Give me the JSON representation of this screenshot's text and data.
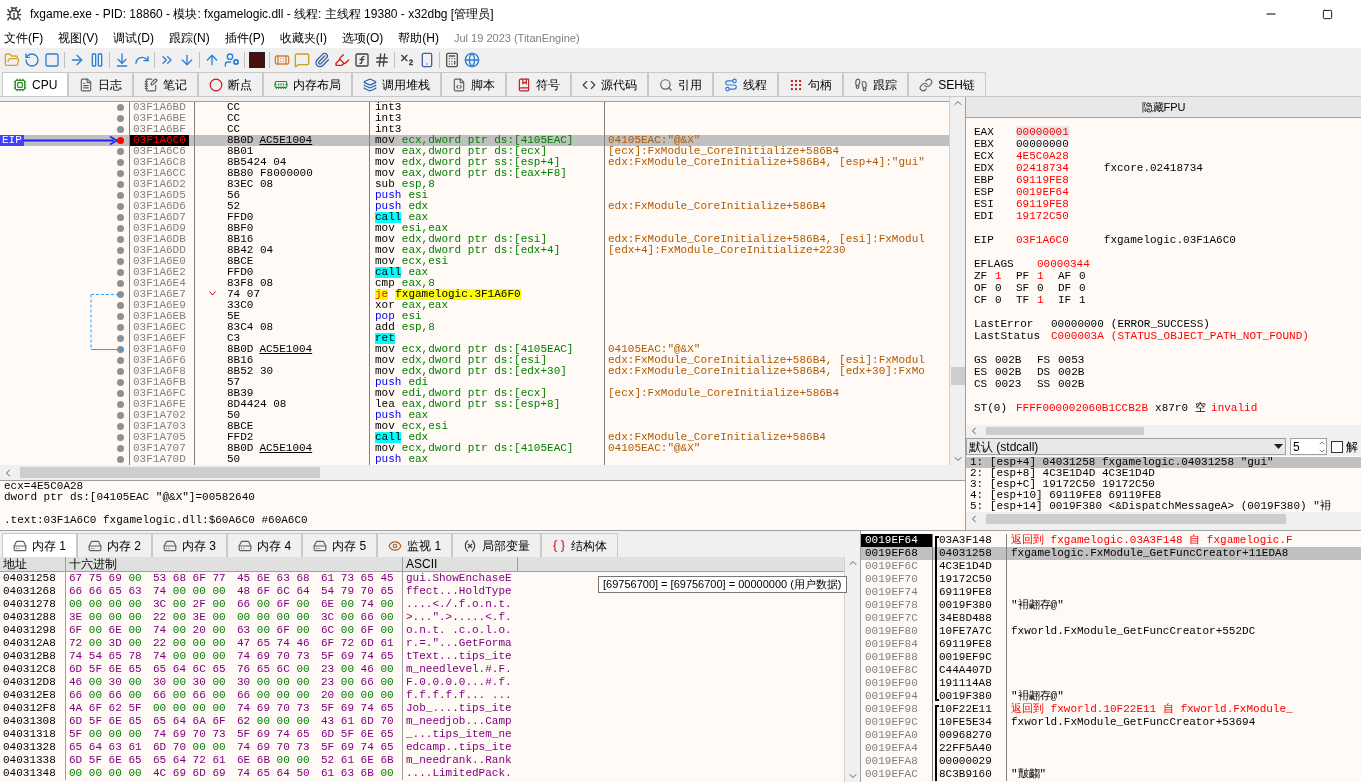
{
  "window": {
    "title": "fxgame.exe - PID: 18860 - 模块: fxgamelogic.dll - 线程: 主线程 19380 - x32dbg [管理员]"
  },
  "menu": [
    "文件(F)",
    "视图(V)",
    "调试(D)",
    "跟踪(N)",
    "插件(P)",
    "收藏夹(I)",
    "选项(O)",
    "帮助(H)"
  ],
  "build_info": "Jul 19 2023 (TitanEngine)",
  "tabs": [
    {
      "label": "CPU",
      "selected": true
    },
    {
      "label": "日志",
      "selected": false
    },
    {
      "label": "笔记",
      "selected": false
    },
    {
      "label": "断点",
      "selected": false
    },
    {
      "label": "内存布局",
      "selected": false
    },
    {
      "label": "调用堆栈",
      "selected": false
    },
    {
      "label": "脚本",
      "selected": false
    },
    {
      "label": "符号",
      "selected": false
    },
    {
      "label": "源代码",
      "selected": false
    },
    {
      "label": "引用",
      "selected": false
    },
    {
      "label": "线程",
      "selected": false
    },
    {
      "label": "句柄",
      "selected": false
    },
    {
      "label": "跟踪",
      "selected": false
    },
    {
      "label": "SEH链",
      "selected": false
    }
  ],
  "eip_label": "EIP",
  "disassembly": [
    {
      "address": "03F1A6BD",
      "bytes": "CC",
      "mnemonic": "int3",
      "kind": "normal",
      "breakpoint": false,
      "selected": false,
      "eip": false,
      "jump_from": false,
      "jump_to": false
    },
    {
      "address": "03F1A6BE",
      "bytes": "CC",
      "mnemonic": "int3",
      "kind": "normal",
      "breakpoint": false,
      "selected": false,
      "eip": false,
      "jump_from": false,
      "jump_to": false
    },
    {
      "address": "03F1A6BF",
      "bytes": "CC",
      "mnemonic": "int3",
      "kind": "normal",
      "breakpoint": false,
      "selected": false,
      "eip": false,
      "jump_from": false,
      "jump_to": false
    },
    {
      "address": "03F1A6C0",
      "bytes": "8B0D",
      "reloc": "AC5E1004",
      "mnemonic": "mov",
      "operands": "ecx,dword ptr ds:[4105EAC]",
      "comment": "04105EAC:\"@&X\"",
      "kind": "normal",
      "breakpoint": true,
      "selected": true,
      "eip": true,
      "jump_from": false,
      "jump_to": false
    },
    {
      "address": "03F1A6C6",
      "bytes": "8B01",
      "mnemonic": "mov",
      "operands": "eax,dword ptr ds:[ecx]",
      "comment": "[ecx]:FxModule_CoreInitialize+586B4",
      "kind": "normal",
      "breakpoint": false,
      "selected": false,
      "eip": false,
      "jump_from": false,
      "jump_to": false
    },
    {
      "address": "03F1A6C8",
      "bytes": "8B5424 04",
      "mnemonic": "mov",
      "operands": "edx,dword ptr ss:[esp+4]",
      "comment": "edx:FxModule_CoreInitialize+586B4, [esp+4]:\"gui\"",
      "kind": "normal",
      "breakpoint": false,
      "selected": false,
      "eip": false,
      "jump_from": false,
      "jump_to": false
    },
    {
      "address": "03F1A6CC",
      "bytes": "8B80 F8000000",
      "mnemonic": "mov",
      "operands": "eax,dword ptr ds:[eax+F8]",
      "kind": "normal",
      "breakpoint": false,
      "selected": false,
      "eip": false,
      "jump_from": false,
      "jump_to": false
    },
    {
      "address": "03F1A6D2",
      "bytes": "83EC 08",
      "mnemonic": "sub",
      "operands": "esp,8",
      "kind": "normal",
      "breakpoint": false,
      "selected": false,
      "eip": false,
      "jump_from": false,
      "jump_to": false
    },
    {
      "address": "03F1A6D5",
      "bytes": "56",
      "mnemonic": "push",
      "operands": "esi",
      "kind": "stack",
      "breakpoint": false,
      "selected": false,
      "eip": false,
      "jump_from": false,
      "jump_to": false
    },
    {
      "address": "03F1A6D6",
      "bytes": "52",
      "mnemonic": "push",
      "operands": "edx",
      "comment": "edx:FxModule_CoreInitialize+586B4",
      "kind": "stack",
      "breakpoint": false,
      "selected": false,
      "eip": false,
      "jump_from": false,
      "jump_to": false
    },
    {
      "address": "03F1A6D7",
      "bytes": "FFD0",
      "mnemonic": "call",
      "operands": "eax",
      "kind": "call",
      "breakpoint": false,
      "selected": false,
      "eip": false,
      "jump_from": false,
      "jump_to": false
    },
    {
      "address": "03F1A6D9",
      "bytes": "8BF0",
      "mnemonic": "mov",
      "operands": "esi,eax",
      "kind": "normal",
      "breakpoint": false,
      "selected": false,
      "eip": false,
      "jump_from": false,
      "jump_to": false
    },
    {
      "address": "03F1A6DB",
      "bytes": "8B16",
      "mnemonic": "mov",
      "operands": "edx,dword ptr ds:[esi]",
      "comment": "edx:FxModule_CoreInitialize+586B4, [esi]:FxModul",
      "kind": "normal",
      "breakpoint": false,
      "selected": false,
      "eip": false,
      "jump_from": false,
      "jump_to": false
    },
    {
      "address": "03F1A6DD",
      "bytes": "8B42 04",
      "mnemonic": "mov",
      "operands": "eax,dword ptr ds:[edx+4]",
      "comment": "[edx+4]:FxModule_CoreInitialize+2230",
      "kind": "normal",
      "breakpoint": false,
      "selected": false,
      "eip": false,
      "jump_from": false,
      "jump_to": false
    },
    {
      "address": "03F1A6E0",
      "bytes": "8BCE",
      "mnemonic": "mov",
      "operands": "ecx,esi",
      "kind": "normal",
      "breakpoint": false,
      "selected": false,
      "eip": false,
      "jump_from": false,
      "jump_to": false
    },
    {
      "address": "03F1A6E2",
      "bytes": "FFD0",
      "mnemonic": "call",
      "operands": "eax",
      "kind": "call",
      "breakpoint": false,
      "selected": false,
      "eip": false,
      "jump_from": false,
      "jump_to": false
    },
    {
      "address": "03F1A6E4",
      "bytes": "83F8 08",
      "mnemonic": "cmp",
      "operands": "eax,8",
      "kind": "normal",
      "breakpoint": false,
      "selected": false,
      "eip": false,
      "jump_from": false,
      "jump_to": false
    },
    {
      "address": "03F1A6E7",
      "bytes": "74 07",
      "mnemonic": "je",
      "operands": "fxgamelogic.3F1A6F0",
      "kind": "jump",
      "breakpoint": false,
      "selected": false,
      "eip": false,
      "jump_from": true,
      "jump_to": false
    },
    {
      "address": "03F1A6E9",
      "bytes": "33C0",
      "mnemonic": "xor",
      "operands": "eax,eax",
      "kind": "normal",
      "breakpoint": false,
      "selected": false,
      "eip": false,
      "jump_from": false,
      "jump_to": false
    },
    {
      "address": "03F1A6EB",
      "bytes": "5E",
      "mnemonic": "pop",
      "operands": "esi",
      "kind": "stack",
      "breakpoint": false,
      "selected": false,
      "eip": false,
      "jump_from": false,
      "jump_to": false
    },
    {
      "address": "03F1A6EC",
      "bytes": "83C4 08",
      "mnemonic": "add",
      "operands": "esp,8",
      "kind": "normal",
      "breakpoint": false,
      "selected": false,
      "eip": false,
      "jump_from": false,
      "jump_to": false
    },
    {
      "address": "03F1A6EF",
      "bytes": "C3",
      "mnemonic": "ret",
      "kind": "call",
      "breakpoint": false,
      "selected": false,
      "eip": false,
      "jump_from": false,
      "jump_to": false
    },
    {
      "address": "03F1A6F0",
      "bytes": "8B0D",
      "reloc": "AC5E1004",
      "mnemonic": "mov",
      "operands": "ecx,dword ptr ds:[4105EAC]",
      "comment": "04105EAC:\"@&X\"",
      "kind": "normal",
      "breakpoint": false,
      "selected": false,
      "eip": false,
      "jump_from": false,
      "jump_to": true
    },
    {
      "address": "03F1A6F6",
      "bytes": "8B16",
      "mnemonic": "mov",
      "operands": "edx,dword ptr ds:[esi]",
      "comment": "edx:FxModule_CoreInitialize+586B4, [esi]:FxModul",
      "kind": "normal",
      "breakpoint": false,
      "selected": false,
      "eip": false,
      "jump_from": false,
      "jump_to": false
    },
    {
      "address": "03F1A6F8",
      "bytes": "8B52 30",
      "mnemonic": "mov",
      "operands": "edx,dword ptr ds:[edx+30]",
      "comment": "edx:FxModule_CoreInitialize+586B4, [edx+30]:FxMo",
      "kind": "normal",
      "breakpoint": false,
      "selected": false,
      "eip": false,
      "jump_from": false,
      "jump_to": false
    },
    {
      "address": "03F1A6FB",
      "bytes": "57",
      "mnemonic": "push",
      "operands": "edi",
      "kind": "stack",
      "breakpoint": false,
      "selected": false,
      "eip": false,
      "jump_from": false,
      "jump_to": false
    },
    {
      "address": "03F1A6FC",
      "bytes": "8B39",
      "mnemonic": "mov",
      "operands": "edi,dword ptr ds:[ecx]",
      "comment": "[ecx]:FxModule_CoreInitialize+586B4",
      "kind": "normal",
      "breakpoint": false,
      "selected": false,
      "eip": false,
      "jump_from": false,
      "jump_to": false
    },
    {
      "address": "03F1A6FE",
      "bytes": "8D4424 08",
      "mnemonic": "lea",
      "operands": "eax,dword ptr ss:[esp+8]",
      "kind": "normal",
      "breakpoint": false,
      "selected": false,
      "eip": false,
      "jump_from": false,
      "jump_to": false
    },
    {
      "address": "03F1A702",
      "bytes": "50",
      "mnemonic": "push",
      "operands": "eax",
      "kind": "stack",
      "breakpoint": false,
      "selected": false,
      "eip": false,
      "jump_from": false,
      "jump_to": false
    },
    {
      "address": "03F1A703",
      "bytes": "8BCE",
      "mnemonic": "mov",
      "operands": "ecx,esi",
      "kind": "normal",
      "breakpoint": false,
      "selected": false,
      "eip": false,
      "jump_from": false,
      "jump_to": false
    },
    {
      "address": "03F1A705",
      "bytes": "FFD2",
      "mnemonic": "call",
      "operands": "edx",
      "comment": "edx:FxModule_CoreInitialize+586B4",
      "kind": "call",
      "breakpoint": false,
      "selected": false,
      "eip": false,
      "jump_from": false,
      "jump_to": false
    },
    {
      "address": "03F1A707",
      "bytes": "8B0D",
      "reloc": "AC5E1004",
      "mnemonic": "mov",
      "operands": "ecx,dword ptr ds:[4105EAC]",
      "comment": "04105EAC:\"@&X\"",
      "kind": "normal",
      "breakpoint": false,
      "selected": false,
      "eip": false,
      "jump_from": false,
      "jump_to": false
    },
    {
      "address": "03F1A70D",
      "bytes": "50",
      "mnemonic": "push",
      "operands": "eax",
      "kind": "stack",
      "breakpoint": false,
      "selected": false,
      "eip": false,
      "jump_from": false,
      "jump_to": false
    }
  ],
  "info_lines": [
    "ecx=4E5C0A28",
    "dword ptr ds:[04105EAC \"@&X\"]=00582640",
    ".text:03F1A6C0 fxgamelogic.dll:$60A6C0 #60A6C0"
  ],
  "registers": {
    "header_button": "隐藏FPU",
    "general": [
      {
        "name": "EAX",
        "value": "00000001",
        "changed": true,
        "selected": true
      },
      {
        "name": "EBX",
        "value": "00000000",
        "changed": false,
        "selected": false
      },
      {
        "name": "ECX",
        "value": "4E5C0A28",
        "changed": true,
        "selected": false
      },
      {
        "name": "EDX",
        "value": "02418734",
        "changed": true,
        "selected": false,
        "comment": "fxcore.02418734"
      },
      {
        "name": "EBP",
        "value": "69119FE8",
        "changed": true,
        "selected": false
      },
      {
        "name": "ESP",
        "value": "0019EF64",
        "changed": true,
        "selected": false
      },
      {
        "name": "ESI",
        "value": "69119FE8",
        "changed": true,
        "selected": false
      },
      {
        "name": "EDI",
        "value": "19172C50",
        "changed": true,
        "selected": false
      }
    ],
    "eip": {
      "name": "EIP",
      "value": "03F1A6C0",
      "changed": true,
      "comment": "fxgamelogic.03F1A6C0"
    },
    "eflags": {
      "name": "EFLAGS",
      "value": "00000344",
      "changed": true
    },
    "flags": [
      [
        {
          "name": "ZF",
          "value": "1",
          "changed": true
        },
        {
          "name": "PF",
          "value": "1",
          "changed": true
        },
        {
          "name": "AF",
          "value": "0",
          "changed": false
        }
      ],
      [
        {
          "name": "OF",
          "value": "0",
          "changed": false
        },
        {
          "name": "SF",
          "value": "0",
          "changed": false
        },
        {
          "name": "DF",
          "value": "0",
          "changed": false
        }
      ],
      [
        {
          "name": "CF",
          "value": "0",
          "changed": false
        },
        {
          "name": "TF",
          "value": "1",
          "changed": true
        },
        {
          "name": "IF",
          "value": "1",
          "changed": false
        }
      ]
    ],
    "status": [
      {
        "name": "LastError",
        "value": "00000000",
        "text": "(ERROR_SUCCESS)",
        "changed": false
      },
      {
        "name": "LastStatus",
        "value": "C000003A",
        "text": "(STATUS_OBJECT_PATH_NOT_FOUND)",
        "changed": true
      }
    ],
    "segments": [
      [
        {
          "name": "GS",
          "value": "002B"
        },
        {
          "name": "FS",
          "value": "0053"
        }
      ],
      [
        {
          "name": "ES",
          "value": "002B"
        },
        {
          "name": "DS",
          "value": "002B"
        }
      ],
      [
        {
          "name": "CS",
          "value": "0023"
        },
        {
          "name": "SS",
          "value": "002B"
        }
      ]
    ],
    "fpu": [
      {
        "name": "ST(0)",
        "value": "FFFF000002060B1CCB2B",
        "tag": "x87r0",
        "state": "空",
        "type": "invalid",
        "changed": true
      }
    ]
  },
  "args": {
    "convention": "默认 (stdcall)",
    "count": "5",
    "checkbox": {
      "label": "解",
      "checked": false
    },
    "rows": [
      {
        "text": "1: [esp+4] 04031258 fxgamelogic.04031258 \"gui\"",
        "selected": true
      },
      {
        "text": "2: [esp+8] 4C3E1D4D 4C3E1D4D",
        "selected": false
      },
      {
        "text": "3: [esp+C] 19172C50 19172C50",
        "selected": false
      },
      {
        "text": "4: [esp+10] 69119FE8 69119FE8",
        "selected": false
      },
      {
        "text": "5: [esp+14] 0019F380 <&DispatchMessageA> (0019F380) \"衻",
        "selected": false
      }
    ]
  },
  "bottom_tabs": [
    {
      "label": "内存 1",
      "selected": true
    },
    {
      "label": "内存 2",
      "selected": false
    },
    {
      "label": "内存 3",
      "selected": false
    },
    {
      "label": "内存 4",
      "selected": false
    },
    {
      "label": "内存 5",
      "selected": false
    },
    {
      "label": "监视 1",
      "selected": false
    },
    {
      "label": "局部变量",
      "selected": false
    },
    {
      "label": "结构体",
      "selected": false
    }
  ],
  "dump": {
    "columns": [
      "地址",
      "十六进制",
      "ASCII"
    ],
    "rows": [
      {
        "address": "04031258",
        "hex": [
          "67 75 69 00",
          "53 68 6F 77",
          "45 6E 63 68",
          "61 73 65 45"
        ],
        "ascii": "gui.ShowEnchaseE"
      },
      {
        "address": "04031268",
        "hex": [
          "66 66 65 63",
          "74 00 00 00",
          "48 6F 6C 64",
          "54 79 70 65"
        ],
        "ascii": "ffect...HoldType"
      },
      {
        "address": "04031278",
        "hex": [
          "00 00 00 00",
          "3C 00 2F 00",
          "66 00 6F 00",
          "6E 00 74 00"
        ],
        "ascii": "....<./.f.o.n.t."
      },
      {
        "address": "04031288",
        "hex": [
          "3E 00 00 00",
          "22 00 3E 00",
          "00 00 00 00",
          "3C 00 66 00"
        ],
        "ascii": ">...\".>.....<.f."
      },
      {
        "address": "04031298",
        "hex": [
          "6F 00 6E 00",
          "74 00 20 00",
          "63 00 6F 00",
          "6C 00 6F 00"
        ],
        "ascii": "o.n.t. .c.o.l.o."
      },
      {
        "address": "040312A8",
        "hex": [
          "72 00 3D 00",
          "22 00 00 00",
          "47 65 74 46",
          "6F 72 6D 61"
        ],
        "ascii": "r.=.\"...GetForma"
      },
      {
        "address": "040312B8",
        "hex": [
          "74 54 65 78",
          "74 00 00 00",
          "74 69 70 73",
          "5F 69 74 65"
        ],
        "ascii": "tText...tips_ite"
      },
      {
        "address": "040312C8",
        "hex": [
          "6D 5F 6E 65",
          "65 64 6C 65",
          "76 65 6C 00",
          "23 00 46 00"
        ],
        "ascii": "m_needlevel.#.F."
      },
      {
        "address": "040312D8",
        "hex": [
          "46 00 30 00",
          "30 00 30 00",
          "30 00 00 00",
          "23 00 66 00"
        ],
        "ascii": "F.0.0.0.0...#.f."
      },
      {
        "address": "040312E8",
        "hex": [
          "66 00 66 00",
          "66 00 66 00",
          "66 00 00 00",
          "20 00 00 00"
        ],
        "ascii": "f.f.f.f.f... ..."
      },
      {
        "address": "040312F8",
        "hex": [
          "4A 6F 62 5F",
          "00 00 00 00",
          "74 69 70 73",
          "5F 69 74 65"
        ],
        "ascii": "Job_....tips_ite"
      },
      {
        "address": "04031308",
        "hex": [
          "6D 5F 6E 65",
          "65 64 6A 6F",
          "62 00 00 00",
          "43 61 6D 70"
        ],
        "ascii": "m_needjob...Camp"
      },
      {
        "address": "04031318",
        "hex": [
          "5F 00 00 00",
          "74 69 70 73",
          "5F 69 74 65",
          "6D 5F 6E 65"
        ],
        "ascii": "_...tips_item_ne"
      },
      {
        "address": "04031328",
        "hex": [
          "65 64 63 61",
          "6D 70 00 00",
          "74 69 70 73",
          "5F 69 74 65"
        ],
        "ascii": "edcamp..tips_ite"
      },
      {
        "address": "04031338",
        "hex": [
          "6D 5F 6E 65",
          "65 64 72 61",
          "6E 6B 00 00",
          "52 61 6E 6B"
        ],
        "ascii": "m_needrank..Rank"
      },
      {
        "address": "04031348",
        "hex": [
          "00 00 00 00",
          "4C 69 6D 69",
          "74 65 64 50",
          "61 63 6B 00"
        ],
        "ascii": "....LimitedPack."
      }
    ]
  },
  "tooltip": "[69756700] = [69756700] = 00000000 (用户数据)",
  "stack": [
    {
      "address": "0019EF64",
      "value": "03A3F148",
      "comment": "返回到 fxgamelogic.03A3F148 自 fxgamelogic.F",
      "kind": "return",
      "frame_start": true,
      "frame_end": false,
      "current": true,
      "selected": false
    },
    {
      "address": "0019EF68",
      "value": "04031258",
      "comment": "fxgamelogic.FxModule_GetFuncCreator+11EDA8",
      "kind": "normal",
      "frame_start": false,
      "frame_end": false,
      "current": false,
      "selected": true
    },
    {
      "address": "0019EF6C",
      "value": "4C3E1D4D",
      "frame_start": false,
      "frame_end": false,
      "current": false,
      "selected": false
    },
    {
      "address": "0019EF70",
      "value": "19172C50",
      "frame_start": false,
      "frame_end": false,
      "current": false,
      "selected": false
    },
    {
      "address": "0019EF74",
      "value": "69119FE8",
      "frame_start": false,
      "frame_end": false,
      "current": false,
      "selected": false
    },
    {
      "address": "0019EF78",
      "value": "0019F380",
      "comment": "\"衻翽存@\"",
      "kind": "normal",
      "frame_start": false,
      "frame_end": false,
      "current": false,
      "selected": false
    },
    {
      "address": "0019EF7C",
      "value": "34E8D488",
      "frame_start": false,
      "frame_end": false,
      "current": false,
      "selected": false
    },
    {
      "address": "0019EF80",
      "value": "10FE7A7C",
      "comment": "fxworld.FxModule_GetFuncCreator+552DC",
      "kind": "normal",
      "frame_start": false,
      "frame_end": false,
      "current": false,
      "selected": false
    },
    {
      "address": "0019EF84",
      "value": "69119FE8",
      "frame_start": false,
      "frame_end": false,
      "current": false,
      "selected": false
    },
    {
      "address": "0019EF88",
      "value": "0019EF9C",
      "frame_start": false,
      "frame_end": false,
      "current": false,
      "selected": false
    },
    {
      "address": "0019EF8C",
      "value": "C44A407D",
      "frame_start": false,
      "frame_end": false,
      "current": false,
      "selected": false
    },
    {
      "address": "0019EF90",
      "value": "191114A8",
      "frame_start": false,
      "frame_end": false,
      "current": false,
      "selected": false
    },
    {
      "address": "0019EF94",
      "value": "0019F380",
      "comment": "\"衻翽存@\"",
      "kind": "normal",
      "frame_start": false,
      "frame_end": true,
      "current": false,
      "selected": false
    },
    {
      "address": "0019EF98",
      "value": "10F22E11",
      "comment": "返回到 fxworld.10F22E11 自 fxworld.FxModule_",
      "kind": "return",
      "frame_start": true,
      "frame_end": false,
      "current": false,
      "selected": false
    },
    {
      "address": "0019EF9C",
      "value": "10FE5E34",
      "comment": "fxworld.FxModule_GetFuncCreator+53694",
      "kind": "normal",
      "frame_start": false,
      "frame_end": false,
      "current": false,
      "selected": false
    },
    {
      "address": "0019EFA0",
      "value": "00968270",
      "frame_start": false,
      "frame_end": false,
      "current": false,
      "selected": false
    },
    {
      "address": "0019EFA4",
      "value": "22FF5A40",
      "frame_start": false,
      "frame_end": false,
      "current": false,
      "selected": false
    },
    {
      "address": "0019EFA8",
      "value": "00000029",
      "frame_start": false,
      "frame_end": false,
      "current": false,
      "selected": false
    },
    {
      "address": "0019EFAC",
      "value": "8C3B9160",
      "comment": "\"皾齺\"",
      "kind": "normal",
      "frame_start": false,
      "frame_end": false,
      "current": false,
      "selected": false
    }
  ]
}
